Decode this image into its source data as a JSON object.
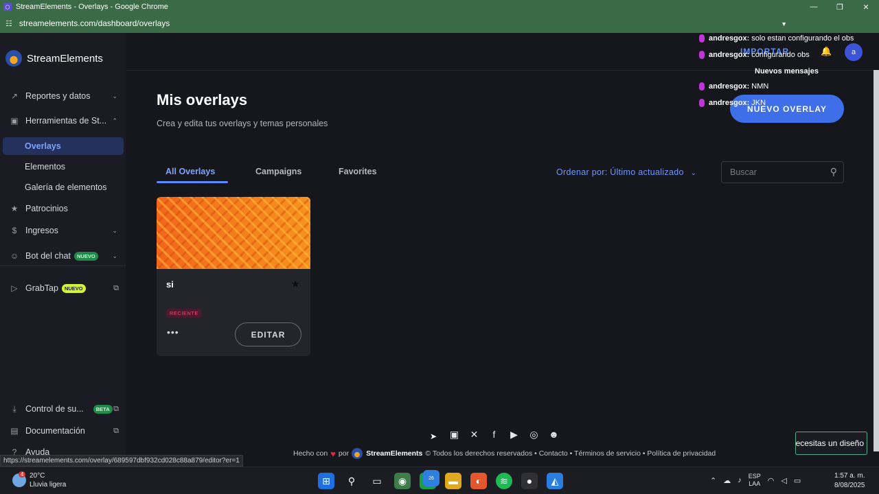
{
  "window": {
    "title": "StreamElements - Overlays - Google Chrome",
    "url": "streamelements.com/dashboard/overlays",
    "minimize_glyph": "—",
    "maximize_glyph": "❐",
    "close_glyph": "✕"
  },
  "sidebar": {
    "brand": "StreamElements",
    "items": [
      {
        "label": "Reportes y datos",
        "icon": "chart-icon"
      },
      {
        "label": "Herramientas de St...",
        "icon": "tools-icon"
      },
      {
        "label": "Overlays"
      },
      {
        "label": "Elementos"
      },
      {
        "label": "Galería de elementos"
      },
      {
        "label": "Patrocinios",
        "icon": "star-icon"
      },
      {
        "label": "Ingresos",
        "icon": "dollar-icon"
      },
      {
        "label": "Bot del chat",
        "icon": "bot-icon",
        "badge": "NUEVO"
      },
      {
        "label": "GrabTap",
        "icon": "grabtap-icon",
        "badge": "NUEVO"
      },
      {
        "label": "Control de su...",
        "icon": "download-icon",
        "badge": "BETA"
      },
      {
        "label": "Documentación",
        "icon": "doc-icon"
      },
      {
        "label": "Ayuda",
        "icon": "help-icon"
      }
    ]
  },
  "header": {
    "importar": "IMPORTAR",
    "avatar_letter": "a",
    "nuevo_overlay": "NUEVO OVERLAY"
  },
  "main": {
    "title": "Mis overlays",
    "subtitle": "Crea y edita tus overlays y temas personales",
    "tabs": [
      {
        "label": "All Overlays",
        "active": true
      },
      {
        "label": "Campaigns"
      },
      {
        "label": "Favorites"
      }
    ],
    "sort_label": "Ordenar por: Último actualizado",
    "search_placeholder": "Buscar",
    "overlays": [
      {
        "name": "si",
        "badge": "RECIENTE",
        "more": "•••",
        "edit_label": "EDITAR"
      }
    ]
  },
  "chat": {
    "messages": [
      {
        "user": "andresgox:",
        "text": "solo estan configurando el obs"
      },
      {
        "user": "andresgox:",
        "text": "configurando obs"
      },
      {
        "user": "andresgox:",
        "text": "NMN"
      },
      {
        "user": "andresgox:",
        "text": "JKN"
      }
    ],
    "new_messages": "Nuevos mensajes"
  },
  "footer": {
    "made_with": "Hecho con",
    "by": "por",
    "brand": "StreamElements",
    "links": "© Todos los derechos reservados • Contacto • Términos de servicio • Política de privacidad",
    "design_button": "Necesitas un diseño",
    "status_url": "https://streamelements.com/overlay/689597dbf932cd028c88a879/editor?er=1",
    "socials": [
      "twitch-icon",
      "x-icon",
      "facebook-icon",
      "youtube-icon",
      "instagram-icon",
      "discord-icon"
    ]
  },
  "taskbar": {
    "weather_badge": "4",
    "temperature": "20°C",
    "weather": "Lluvia ligera",
    "whatsapp_badge": "26",
    "lang_top": "ESP",
    "lang_bottom": "LAA",
    "time": "1:57 a. m.",
    "date": "8/08/2025"
  },
  "colors": {
    "accent": "#3e6ee8",
    "chrome_bar": "#3a6a46",
    "background": "#16171d",
    "sidebar": "#1b1c23"
  }
}
